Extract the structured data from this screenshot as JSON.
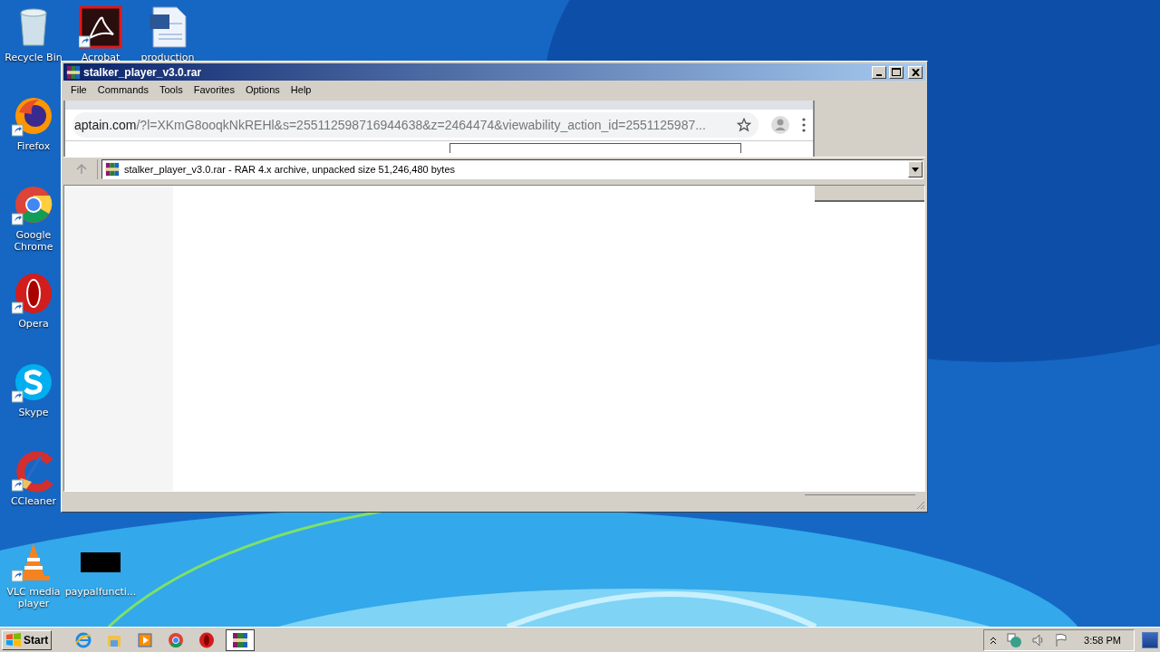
{
  "desktop_icons": [
    {
      "label": "Recycle Bin",
      "kind": "bin"
    },
    {
      "label": "Acrobat",
      "kind": "acrobat"
    },
    {
      "label": "production",
      "kind": "word"
    },
    {
      "label": "Firefox",
      "kind": "firefox"
    },
    {
      "label": "Google Chrome",
      "kind": "chrome"
    },
    {
      "label": "Opera",
      "kind": "opera"
    },
    {
      "label": "Skype",
      "kind": "skype"
    },
    {
      "label": "CCleaner",
      "kind": "ccleaner"
    },
    {
      "label": "VLC media player",
      "kind": "vlc"
    },
    {
      "label": "paypalfuncti...",
      "kind": "black"
    }
  ],
  "window": {
    "title": "stalker_player_v3.0.rar",
    "menu": [
      "File",
      "Commands",
      "Tools",
      "Favorites",
      "Options",
      "Help"
    ],
    "browser_fragment": {
      "url_host": "aptain.com",
      "url_path": "/?l=XKmG8ooqkNkREHl&s=255112598716944638&z=2464474&viewability_action_id=2551125987..."
    },
    "address": "stalker_player_v3.0.rar - RAR 4.x archive, unpacked size 51,246,480 bytes"
  },
  "taskbar": {
    "start": "Start",
    "buttons": [
      {
        "kind": "ie",
        "selected": false
      },
      {
        "kind": "explorer",
        "selected": false
      },
      {
        "kind": "media",
        "selected": false
      },
      {
        "kind": "chrome",
        "selected": false
      },
      {
        "kind": "opera",
        "selected": false
      },
      {
        "kind": "winrar",
        "selected": true
      }
    ],
    "time": "3:58 PM"
  }
}
